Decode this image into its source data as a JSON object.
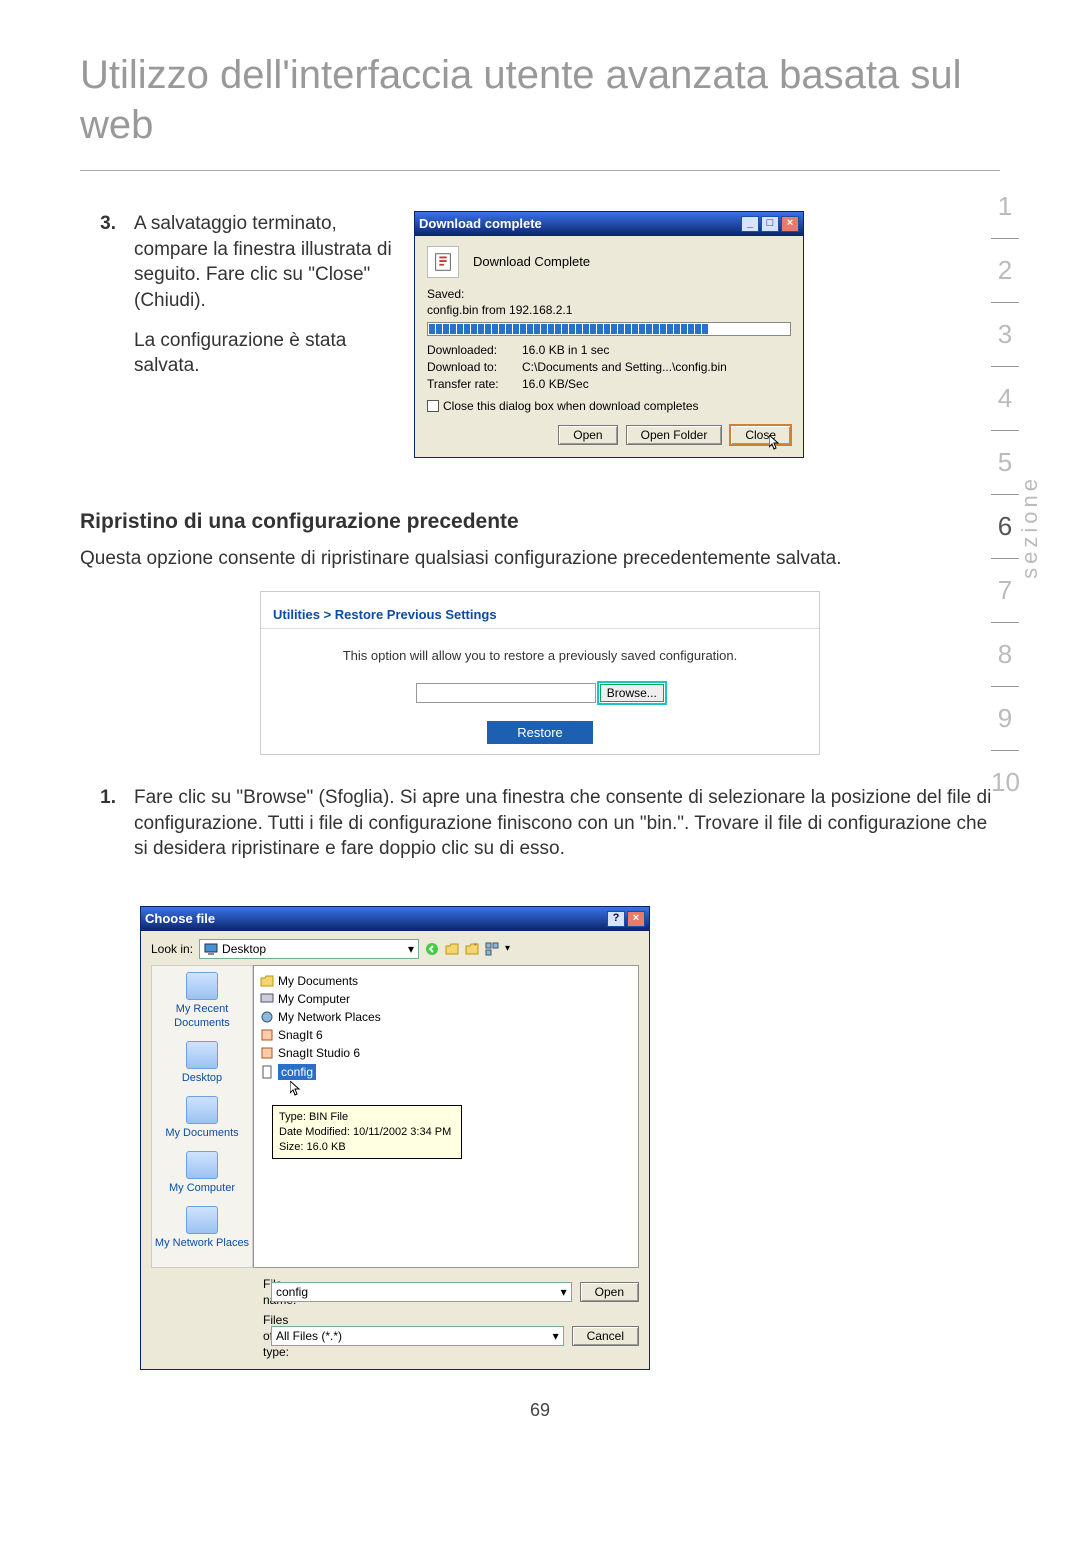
{
  "page_title": "Utilizzo dell'interfaccia utente avanzata basata sul web",
  "step3": {
    "num": "3.",
    "text": "A salvataggio terminato, compare la finestra illustrata di seguito. Fare clic su \"Close\" (Chiudi).",
    "text2": "La configurazione è stata salvata."
  },
  "dl_dialog": {
    "title": "Download complete",
    "min": "_",
    "max": "□",
    "close": "×",
    "label": "Download Complete",
    "saved_label": "Saved:",
    "saved_value": "config.bin from 192.168.2.1",
    "downloaded_label": "Downloaded:",
    "downloaded_value": "16.0 KB in 1 sec",
    "downloadto_label": "Download to:",
    "downloadto_value": "C:\\Documents and Setting...\\config.bin",
    "rate_label": "Transfer rate:",
    "rate_value": "16.0 KB/Sec",
    "chk_label": "Close this dialog box when download completes",
    "open": "Open",
    "open_folder": "Open Folder",
    "close_btn": "Close"
  },
  "section": {
    "heading": "Ripristino di una configurazione precedente",
    "text": "Questa opzione consente di ripristinare qualsiasi configurazione precedentemente salvata."
  },
  "restore_panel": {
    "head": "Utilities > Restore Previous Settings",
    "msg": "This option will allow you to restore a previously saved configuration.",
    "browse": "Browse...",
    "restore": "Restore"
  },
  "step1": {
    "num": "1.",
    "text": "Fare clic su \"Browse\" (Sfoglia). Si apre una finestra che consente di selezionare la posizione del file di configurazione. Tutti i file di configurazione finiscono con un \"bin.\". Trovare il file di configurazione che si desidera ripristinare e fare doppio clic su di esso."
  },
  "choose_dialog": {
    "title": "Choose file",
    "help": "?",
    "close": "×",
    "lookin_label": "Look in:",
    "lookin_value": "Desktop",
    "places": [
      "My Recent Documents",
      "Desktop",
      "My Documents",
      "My Computer",
      "My Network Places"
    ],
    "items": [
      "My Documents",
      "My Computer",
      "My Network Places",
      "SnagIt 6",
      "SnagIt Studio 6"
    ],
    "sel_item": "config",
    "tooltip_type": "Type: BIN File",
    "tooltip_date": "Date Modified: 10/11/2002 3:34 PM",
    "tooltip_size": "Size: 16.0 KB",
    "filename_label": "File name:",
    "filename_value": "config",
    "filetype_label": "Files of type:",
    "filetype_value": "All Files (*.*)",
    "open": "Open",
    "cancel": "Cancel"
  },
  "nav": [
    "1",
    "2",
    "3",
    "4",
    "5",
    "6",
    "7",
    "8",
    "9",
    "10"
  ],
  "nav_active": "6",
  "nav_label": "sezione",
  "page_number": "69"
}
